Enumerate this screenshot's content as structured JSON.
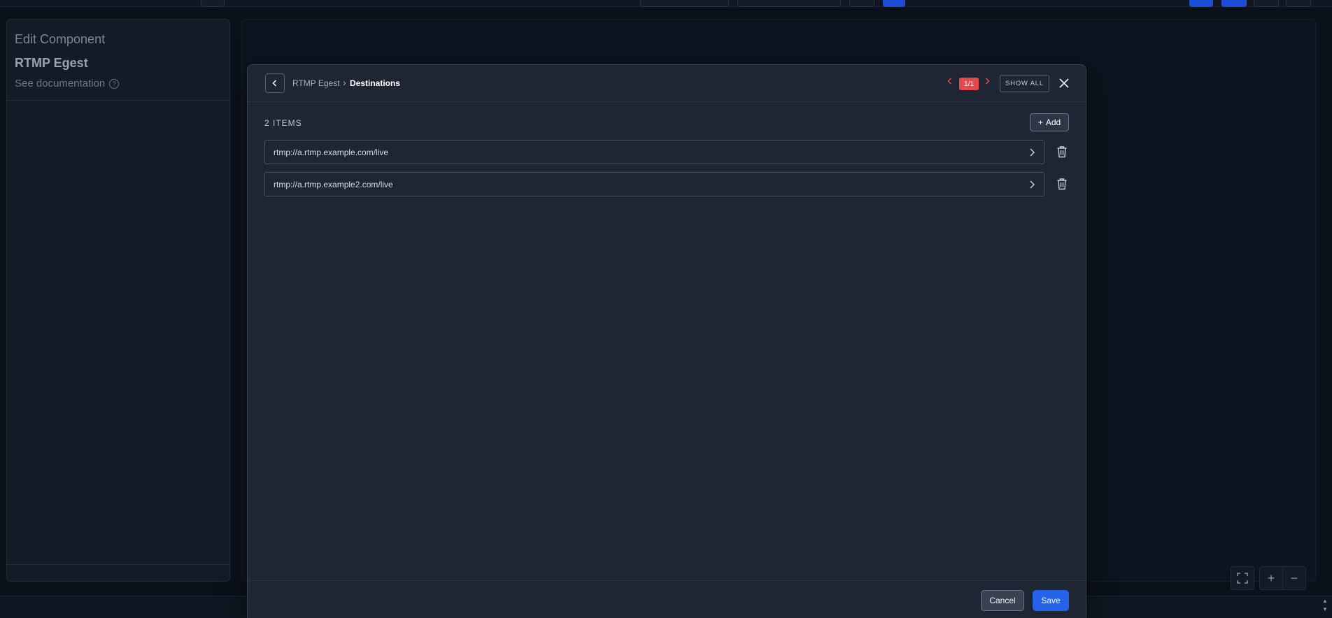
{
  "left_panel": {
    "title": "Edit Component",
    "component_name": "RTMP Egest",
    "doc_link": "See documentation",
    "help_icon": "?"
  },
  "canvas_controls": {
    "zoom_in": "+",
    "zoom_out": "−"
  },
  "modal": {
    "breadcrumb": {
      "root": "RTMP Egest",
      "separator": "›",
      "current": "Destinations"
    },
    "pagination": {
      "badge": "1/1"
    },
    "show_all_label": "SHOW ALL",
    "items_count": "2 ITEMS",
    "add_label": "Add",
    "items": [
      {
        "url": "rtmp://a.rtmp.example.com/live"
      },
      {
        "url": "rtmp://a.rtmp.example2.com/live"
      }
    ],
    "footer": {
      "cancel_label": "Cancel",
      "save_label": "Save"
    }
  },
  "colors": {
    "accent_blue": "#2563eb",
    "badge_red": "#e5484d",
    "modal_bg": "#1f2532"
  }
}
